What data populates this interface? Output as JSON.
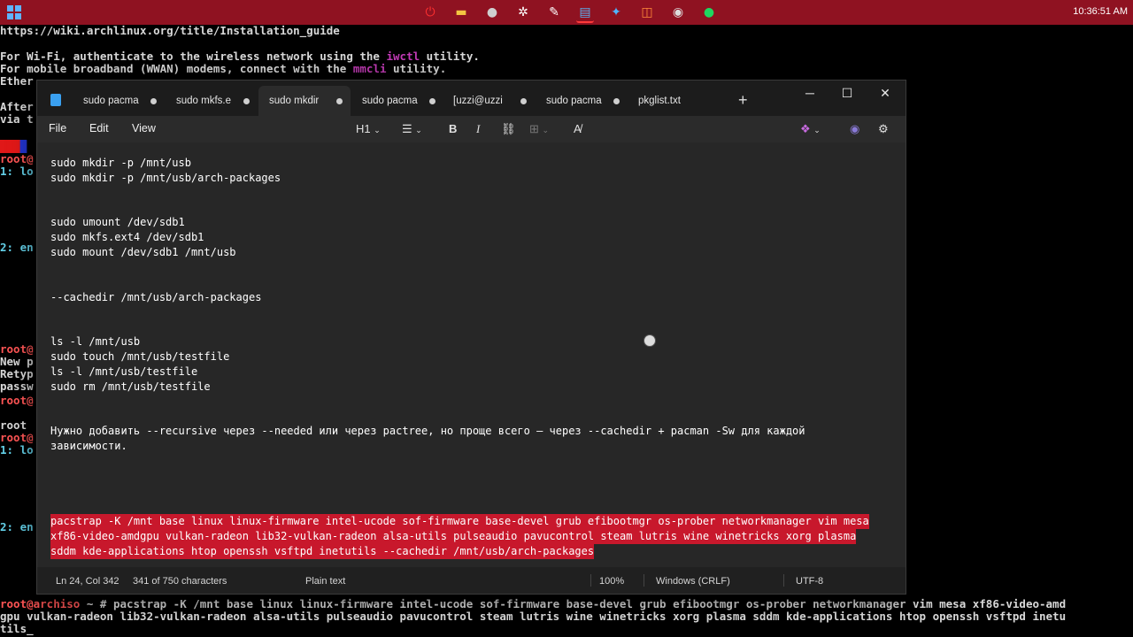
{
  "taskbar": {
    "clock": "10:36:51 AM",
    "icons": [
      "windows-start-icon",
      "red-app-icon",
      "file-explorer-icon",
      "obs-icon",
      "chatgpt-icon",
      "tool-icon",
      "notepad-icon",
      "vscode-icon",
      "screenshot-icon",
      "chrome-icon",
      "spotify-icon"
    ]
  },
  "terminal": {
    "url_line": "https://wiki.archlinux.org/title/Installation_guide",
    "wifi_line_a": "For Wi-Fi, authenticate to the wireless network using the ",
    "wifi_tool": "iwctl",
    "wifi_line_b": " utility.",
    "mobile_line_a": "For mobile broadband (WWAN) modems, connect with the ",
    "mobile_tool": "mmcli",
    "mobile_line_b": " utility.",
    "ether_line": "Ether",
    "after_line": "After",
    "via_line": "via t",
    "cmd_prompt": "root@archiso",
    "cmd_line1": " ~ # pacstrap -K /mnt base linux linux-firmware intel-ucode sof-firmware base-devel grub efibootmgr os-prober networkmanager vim mesa xf86-video-amd",
    "cmd_line2": "gpu vulkan-radeon lib32-vulkan-radeon alsa-utils pulseaudio pavucontrol steam lutris wine winetricks xorg plasma sddm kde-applications htop openssh vsftpd inetu",
    "cmd_line3": "tils_"
  },
  "notepad": {
    "tabs": [
      {
        "label": "sudo pacma",
        "active": false
      },
      {
        "label": "sudo mkfs.e",
        "active": false
      },
      {
        "label": "sudo mkdir",
        "active": true
      },
      {
        "label": "sudo pacma",
        "active": false
      },
      {
        "label": "[uzzi@uzzi",
        "active": false
      },
      {
        "label": "sudo pacma",
        "active": false
      },
      {
        "label": "pkglist.txt",
        "active": false
      }
    ],
    "new_tab": "+",
    "window_controls": {
      "minimize": "─",
      "maximize": "☐",
      "close": "✕"
    },
    "menu": {
      "file": "File",
      "edit": "Edit",
      "view": "View"
    },
    "format": {
      "heading": "H1",
      "bold": "B",
      "italic": "I"
    },
    "lines": [
      "sudo mkdir -p /mnt/usb",
      "sudo mkdir -p /mnt/usb/arch-packages",
      "sudo umount /dev/sdb1",
      "sudo mkfs.ext4 /dev/sdb1",
      "sudo mount /dev/sdb1 /mnt/usb",
      "--cachedir /mnt/usb/arch-packages",
      "ls -l /mnt/usb",
      "sudo touch /mnt/usb/testfile",
      "ls -l /mnt/usb/testfile",
      "sudo rm /mnt/usb/testfile",
      "Нужно добавить --recursive через --needed или через pactree, но проще всего — через --cachedir + pacman -Sw для каждой",
      "зависимости.",
      "pacstrap -K /mnt base linux linux-firmware intel-ucode sof-firmware base-devel grub efibootmgr os-prober networkmanager vim mesa",
      "xf86-video-amdgpu vulkan-radeon lib32-vulkan-radeon alsa-utils pulseaudio pavucontrol steam lutris wine winetricks xorg plasma",
      "sddm kde-applications htop openssh vsftpd inetutils --cachedir /mnt/usb/arch-packages"
    ],
    "status": {
      "position": "Ln 24, Col 342",
      "chars": "341 of 750 characters",
      "format": "Plain text",
      "zoom": "100%",
      "line_ending": "Windows (CRLF)",
      "encoding": "UTF-8"
    }
  },
  "colors": {
    "taskbar": "#8f1221",
    "selection": "#c8182c",
    "editor_bg": "#272727"
  }
}
